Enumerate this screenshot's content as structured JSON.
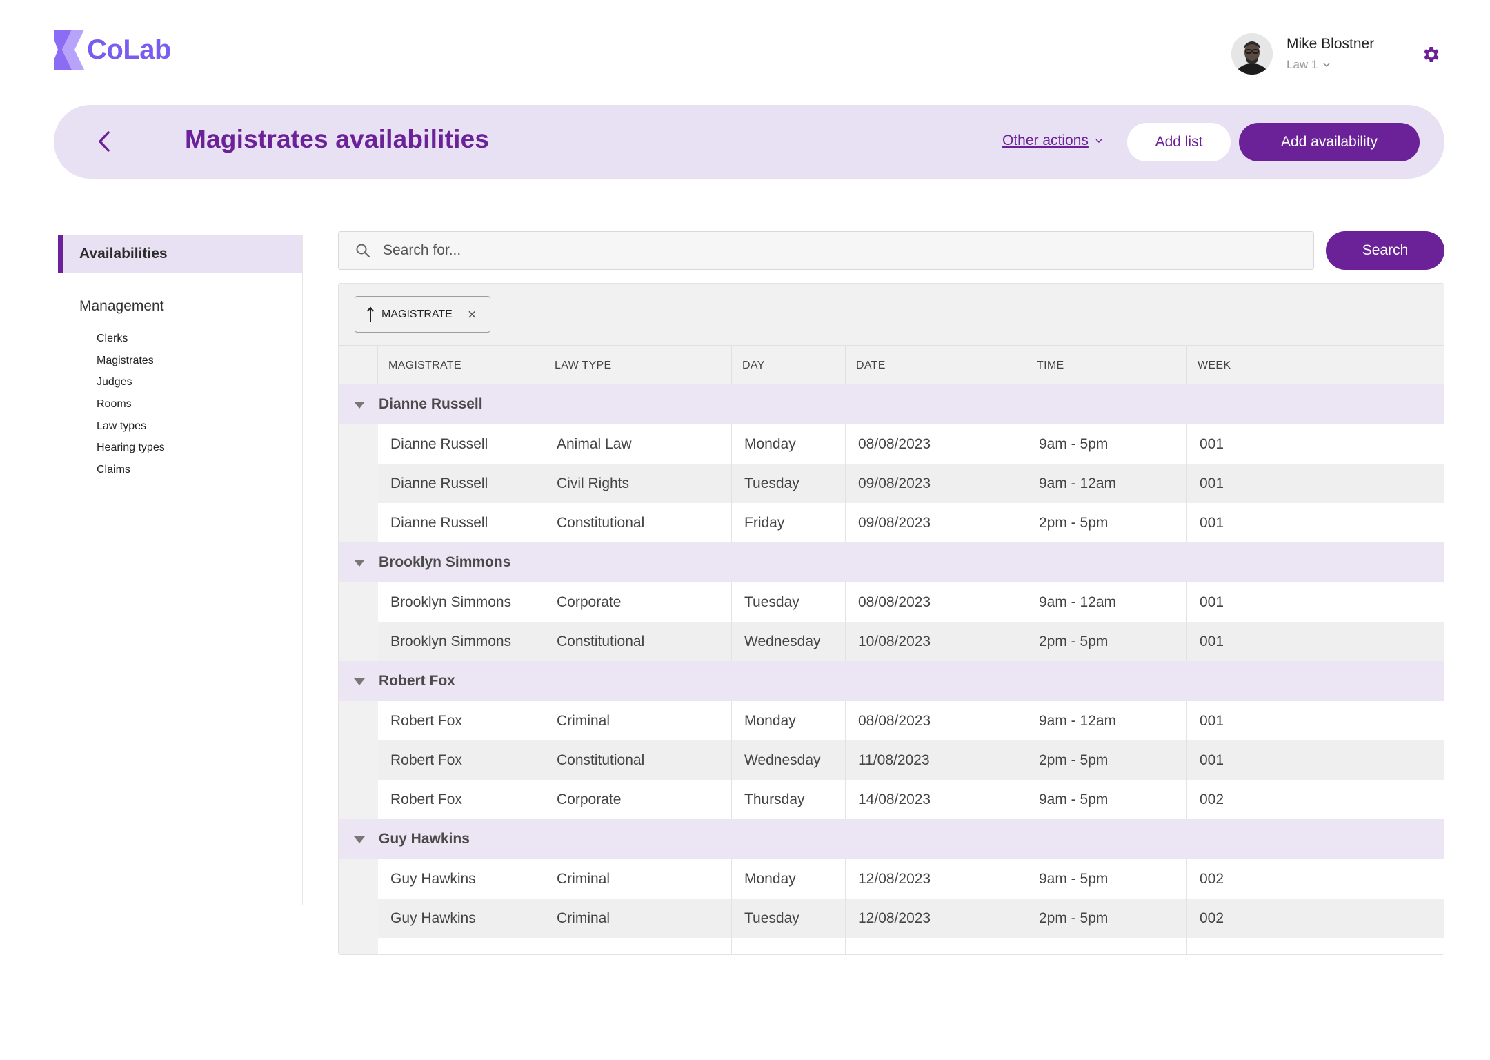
{
  "brand": {
    "name": "CoLab",
    "color": "#7b5cf0"
  },
  "user": {
    "name": "Mike Blostner",
    "org": "Law 1"
  },
  "header": {
    "title": "Magistrates availabilities",
    "other_actions": "Other actions",
    "add_list": "Add list",
    "add_availability": "Add availability"
  },
  "sidebar": {
    "active": "Availabilities",
    "section": "Management",
    "items": [
      "Clerks",
      "Magistrates",
      "Judges",
      "Rooms",
      "Law types",
      "Hearing types",
      "Claims"
    ]
  },
  "search": {
    "placeholder": "Search for...",
    "button": "Search"
  },
  "sort_chip": {
    "label": "MAGISTRATE"
  },
  "table": {
    "columns": [
      "MAGISTRATE",
      "LAW TYPE",
      "DAY",
      "DATE",
      "TIME",
      "WEEK"
    ],
    "groups": [
      {
        "name": "Dianne Russell",
        "rows": [
          [
            "Dianne Russell",
            "Animal Law",
            "Monday",
            "08/08/2023",
            "9am - 5pm",
            "001"
          ],
          [
            "Dianne Russell",
            "Civil Rights",
            "Tuesday",
            "09/08/2023",
            "9am - 12am",
            "001"
          ],
          [
            "Dianne Russell",
            "Constitutional",
            "Friday",
            "09/08/2023",
            "2pm - 5pm",
            "001"
          ]
        ]
      },
      {
        "name": "Brooklyn Simmons",
        "rows": [
          [
            "Brooklyn Simmons",
            "Corporate",
            "Tuesday",
            "08/08/2023",
            "9am - 12am",
            "001"
          ],
          [
            "Brooklyn Simmons",
            "Constitutional",
            "Wednesday",
            "10/08/2023",
            "2pm - 5pm",
            "001"
          ]
        ]
      },
      {
        "name": "Robert Fox",
        "rows": [
          [
            "Robert Fox",
            "Criminal",
            "Monday",
            "08/08/2023",
            "9am - 12am",
            "001"
          ],
          [
            "Robert Fox",
            "Constitutional",
            "Wednesday",
            "11/08/2023",
            "2pm - 5pm",
            "001"
          ],
          [
            "Robert Fox",
            "Corporate",
            "Thursday",
            "14/08/2023",
            "9am - 5pm",
            "002"
          ]
        ]
      },
      {
        "name": "Guy Hawkins",
        "rows": [
          [
            "Guy Hawkins",
            "Criminal",
            "Monday",
            "12/08/2023",
            "9am - 5pm",
            "002"
          ],
          [
            "Guy Hawkins",
            "Criminal",
            "Tuesday",
            "12/08/2023",
            "2pm - 5pm",
            "002"
          ],
          [
            "",
            "",
            "",
            "",
            "",
            ""
          ]
        ]
      }
    ]
  },
  "icons": {
    "logo": "colab-chevron-logo",
    "settings": "gear-icon",
    "back": "chevron-left-icon",
    "search": "search-icon",
    "sort": "arrow-up-icon",
    "remove": "close-icon",
    "expand": "caret-down-icon"
  },
  "colors": {
    "primary": "#6b2197",
    "band": "#e8e0f3",
    "group": "#ece5f3"
  }
}
